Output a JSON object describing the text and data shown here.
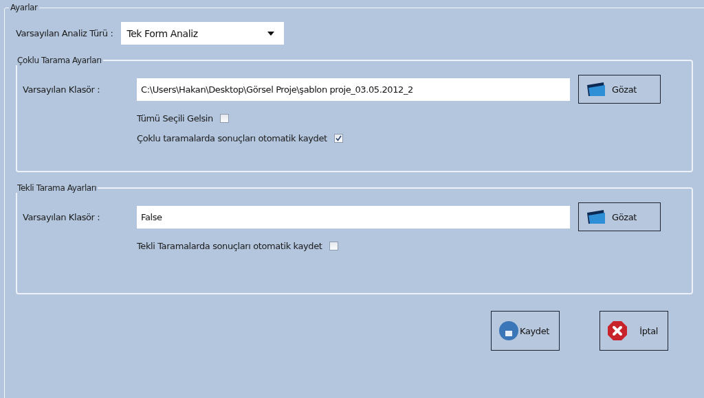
{
  "settings_group": {
    "title": "Ayarlar",
    "analysis_type": {
      "label": "Varsayılan Analiz Türü :",
      "value": "Tek Form Analiz"
    },
    "groups": [
      {
        "title": "Çoklu Tarama Ayarları",
        "folder_label": "Varsayılan Klasör :",
        "folder_value": "C:\\Users\\Hakan\\Desktop\\Görsel Proje\\şablon proje_03.05.2012_2",
        "browse_button": "Gözat",
        "checkboxes": [
          {
            "label": "Tümü Seçili Gelsin",
            "checked": false
          },
          {
            "label": "Çoklu taramalarda sonuçları otomatik kaydet",
            "checked": true
          }
        ]
      },
      {
        "title": "Tekli Tarama Ayarları",
        "folder_label": "Varsayılan Klasör :",
        "folder_value": "False",
        "browse_button": "Gözat",
        "checkboxes": [
          {
            "label": "Tekli Taramalarda sonuçları otomatik kaydet",
            "checked": false
          }
        ]
      }
    ],
    "buttons": [
      {
        "kind": "save",
        "label": "Kaydet"
      },
      {
        "kind": "cancel",
        "label": "İptal"
      }
    ]
  }
}
